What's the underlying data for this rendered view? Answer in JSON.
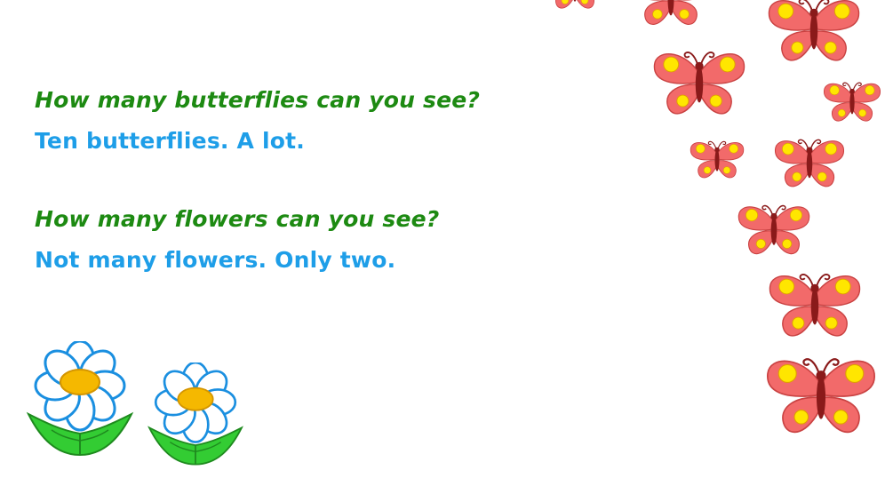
{
  "lines": {
    "question_1": "How many butterflies can you see?",
    "answer_1": "Ten butterflies. A lot.",
    "question_2": "How many flowers can you see?",
    "answer_2": "Not many flowers. Only two."
  },
  "colors": {
    "question_text": "#1d8a12",
    "answer_text": "#1e9ee8",
    "butterfly_wing": "#f26a6a",
    "butterfly_body": "#8a1a1a",
    "butterfly_spot": "#ffe600",
    "flower_petal": "#ffffff",
    "flower_outline": "#1a8fe0",
    "flower_center": "#f5b800",
    "leaf": "#33cc33"
  },
  "icons": {
    "butterfly": "butterfly-icon",
    "flower": "flower-icon"
  }
}
